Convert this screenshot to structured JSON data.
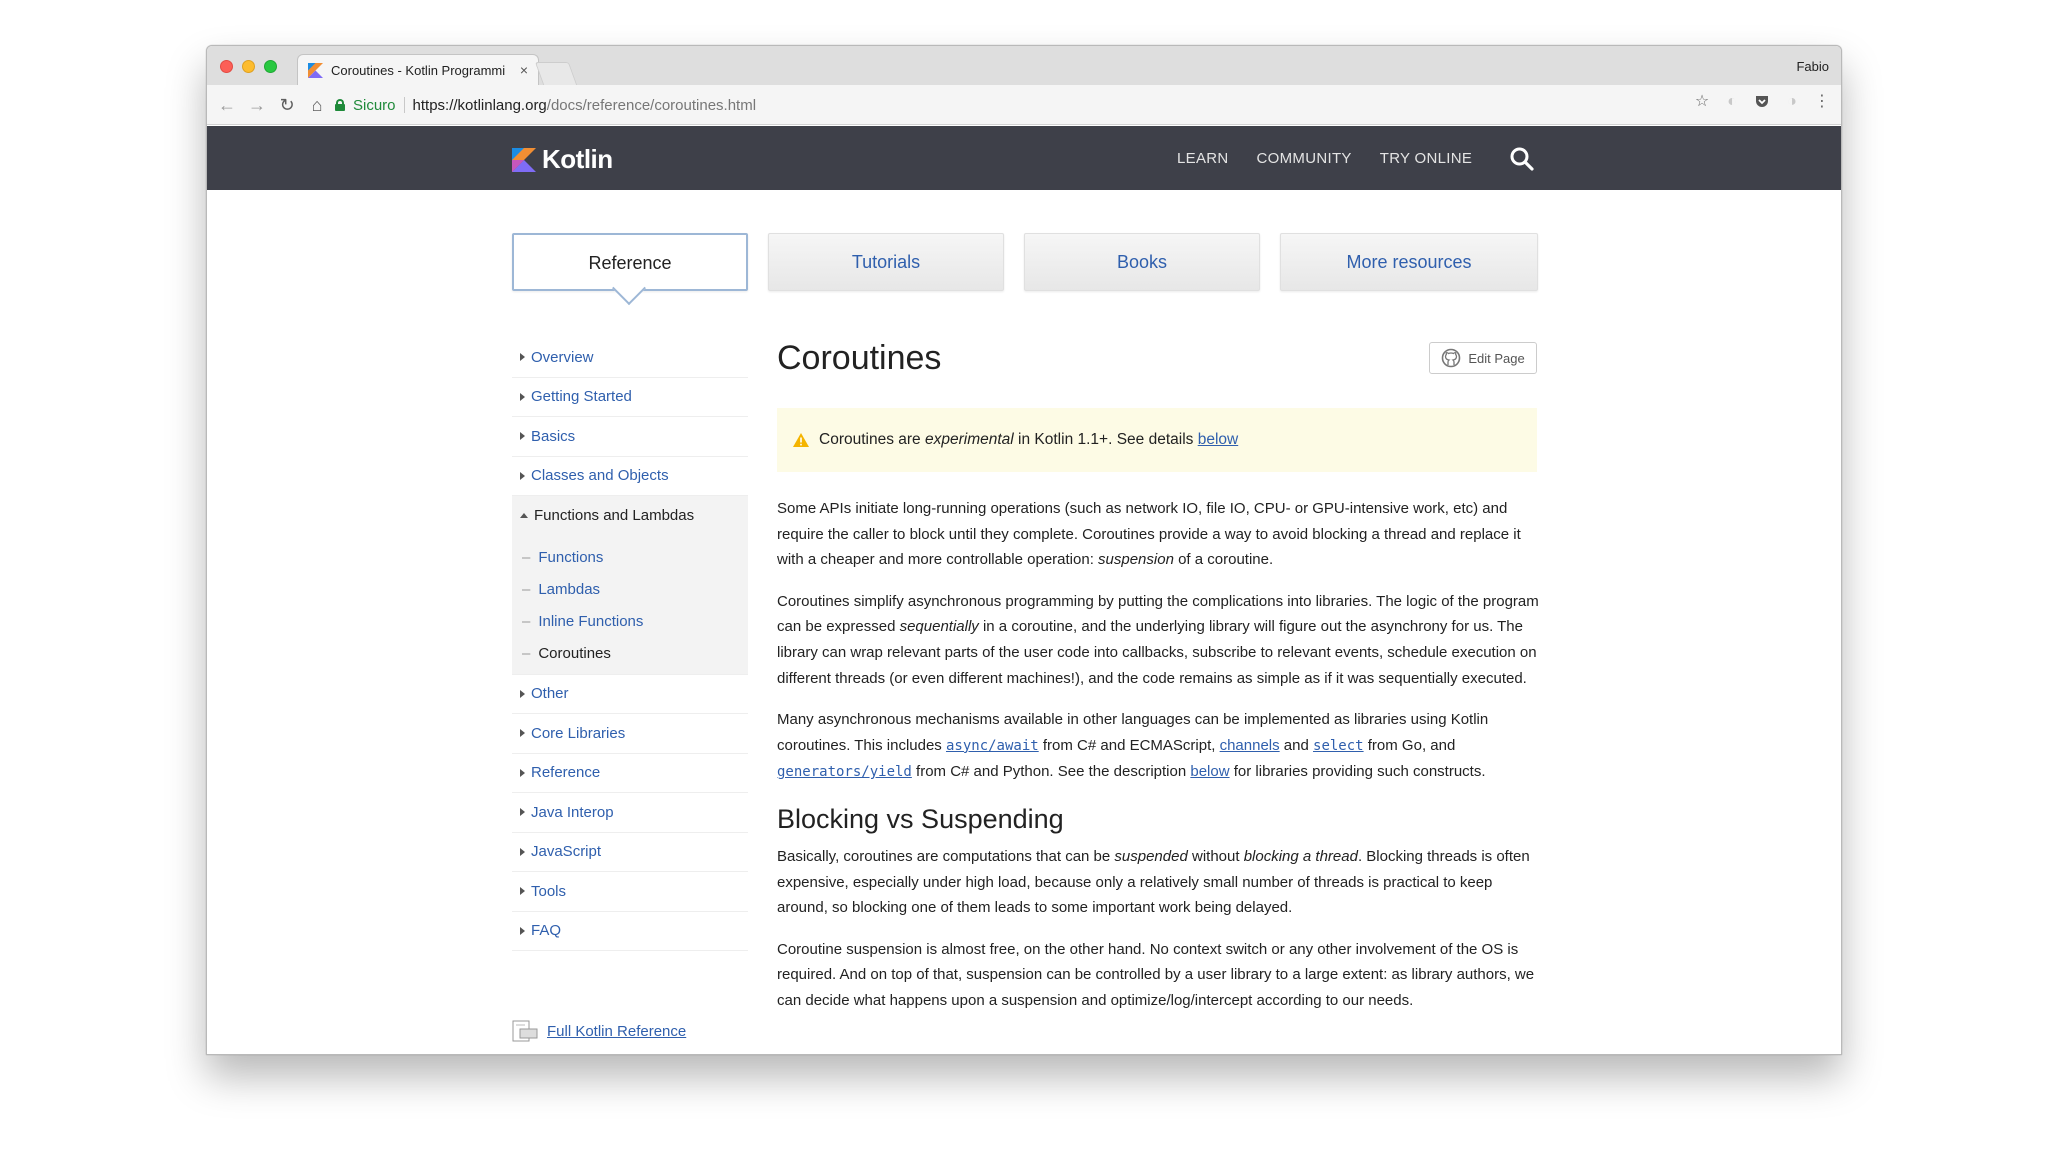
{
  "browser": {
    "tab_title": "Coroutines - Kotlin Programmi",
    "tab_close": "×",
    "profile": "Fabio",
    "secure_label": "Sicuro",
    "url_host": "https://kotlinlang.org",
    "url_path": "/docs/reference/coroutines.html",
    "icons": {
      "back": "arrow-left-icon",
      "forward": "arrow-right-icon",
      "reload": "reload-icon",
      "home": "home-icon",
      "star": "star-icon",
      "menu": "kebab-menu-icon"
    }
  },
  "site": {
    "logo_text": "Kotlin",
    "nav": [
      "LEARN",
      "COMMUNITY",
      "TRY ONLINE"
    ],
    "header_color": "#3e4049",
    "link_color": "#2f5fad"
  },
  "doc_tabs": [
    "Reference",
    "Tutorials",
    "Books",
    "More resources"
  ],
  "sidebar": {
    "items_top": [
      "Overview",
      "Getting Started",
      "Basics",
      "Classes and Objects"
    ],
    "open_item": "Functions and Lambdas",
    "sub_items": [
      "Functions",
      "Lambdas",
      "Inline Functions",
      "Coroutines"
    ],
    "items_bottom": [
      "Other",
      "Core Libraries",
      "Reference",
      "Java Interop",
      "JavaScript",
      "Tools",
      "FAQ"
    ],
    "full_reference": "Full Kotlin Reference"
  },
  "main": {
    "title": "Coroutines",
    "edit_button": "Edit Page",
    "warning": {
      "pre": "Coroutines are ",
      "em": "experimental",
      "post": " in Kotlin 1.1+. See details ",
      "link": "below"
    },
    "p1": {
      "a": "Some APIs initiate long-running operations (such as network IO, file IO, CPU- or GPU-intensive work, etc) and require the caller to block until they complete. Coroutines provide a way to avoid blocking a thread and replace it with a cheaper and more controllable operation: ",
      "em": "suspension",
      "b": " of a coroutine."
    },
    "p2": {
      "a": "Coroutines simplify asynchronous programming by putting the complications into libraries. The logic of the program can be expressed ",
      "em": "sequentially",
      "b": " in a coroutine, and the underlying library will figure out the asynchrony for us. The library can wrap relevant parts of the user code into callbacks, subscribe to relevant events, schedule execution on different threads (or even different machines!), and the code remains as simple as if it was sequentially executed."
    },
    "p3": {
      "a": "Many asynchronous mechanisms available in other languages can be implemented as libraries using Kotlin coroutines. This includes ",
      "code1": "async/await",
      "b": " from C# and ECMAScript, ",
      "link1": "channels",
      "c": " and ",
      "code2": "select",
      "d": " from Go, and ",
      "code3": "generators/yield",
      "e": " from C# and Python. See the description ",
      "link2": "below",
      "f": " for libraries providing such constructs."
    },
    "h2": "Blocking vs Suspending",
    "p4": {
      "a": "Basically, coroutines are computations that can be ",
      "em1": "suspended",
      "b": " without ",
      "em2": "blocking a thread",
      "c": ". Blocking threads is often expensive, especially under high load, because only a relatively small number of threads is practical to keep around, so blocking one of them leads to some important work being delayed."
    },
    "p5": "Coroutine suspension is almost free, on the other hand. No context switch or any other involvement of the OS is required. And on top of that, suspension can be controlled by a user library to a large extent: as library authors, we can decide what happens upon a suspension and optimize/log/intercept according to our needs."
  }
}
